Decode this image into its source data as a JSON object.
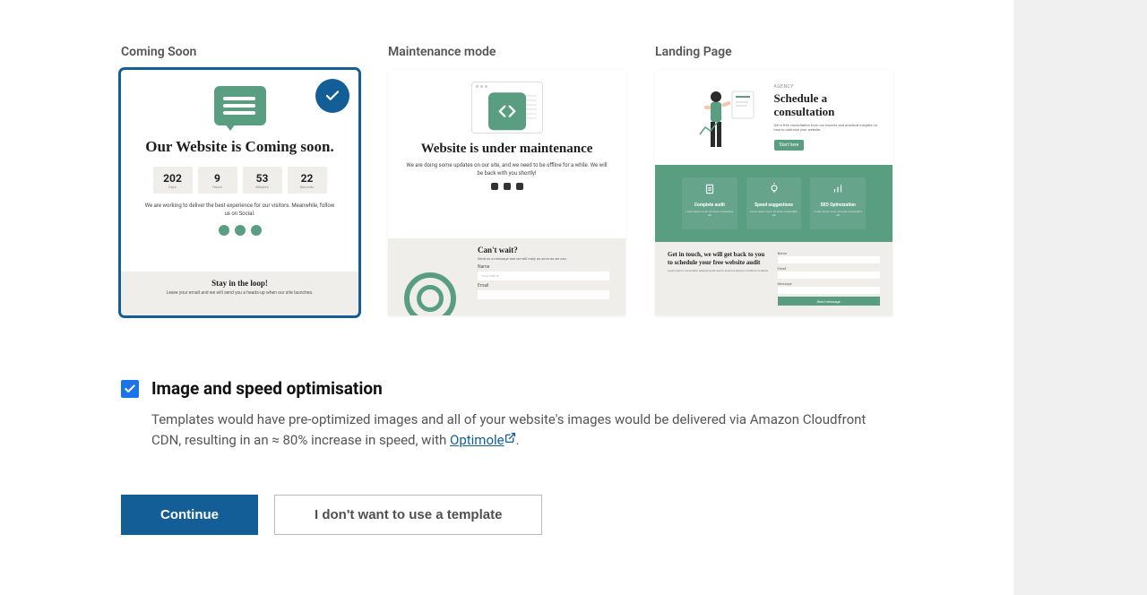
{
  "templates": {
    "comingSoon": {
      "label": "Coming Soon",
      "heading": "Our Website is Coming soon.",
      "countdown": [
        {
          "v": "202",
          "u": "Days"
        },
        {
          "v": "9",
          "u": "Hours"
        },
        {
          "v": "53",
          "u": "Minutes"
        },
        {
          "v": "22",
          "u": "Seconds"
        }
      ],
      "desc": "We are working to deliver the best experience for our visitors. Meanwhile, follow us on Social.",
      "loopTitle": "Stay in the loop!",
      "loopDesc": "Leave your email and we will send you a heads-up when our site launches."
    },
    "maintenance": {
      "label": "Maintenance mode",
      "heading": "Website is under maintenance",
      "desc": "We are doing some updates on our site, and we need to be offline for a while. We will be back with you shortly!",
      "waitTitle": "Can't wait?",
      "waitDesc": "Send us a message and we will reply as soon as we can.",
      "nameLabel": "Name",
      "namePh": "Your Name",
      "emailLabel": "Email"
    },
    "landing": {
      "label": "Landing Page",
      "brand": "AGENCY",
      "heading": "Schedule a consultation",
      "para": "Get a free consultation from our experts and practical insights on how to optimize your website.",
      "cta": "Start here",
      "features": [
        {
          "t": "Complete audit",
          "d": "Lorem ipsum dolor sit amet consectetur elit"
        },
        {
          "t": "Speed suggestions",
          "d": "Lorem ipsum dolor sit amet consectetur elit"
        },
        {
          "t": "SEO Optimization",
          "d": "Lorem ipsum dolor sit amet consectetur elit"
        }
      ],
      "contactH": "Get in touch, we will get back to you to schedule your free website audit",
      "contactP": "Lorem ipsum consectetur adipiscing elit sed do eiusmod tempor incididunt ut labore.",
      "fName": "Name",
      "fEmail": "Email",
      "fMsg": "Message",
      "send": "Send message"
    }
  },
  "optimisation": {
    "checked": true,
    "title": "Image and speed optimisation",
    "descStart": "Templates would have pre-optimized images and all of your website's images would be delivered via Amazon Cloudfront CDN, resulting in an ≈ 80% increase in speed, with ",
    "link": "Optimole",
    "descEnd": "."
  },
  "buttons": {
    "continue": "Continue",
    "skip": "I don't want to use a template"
  }
}
